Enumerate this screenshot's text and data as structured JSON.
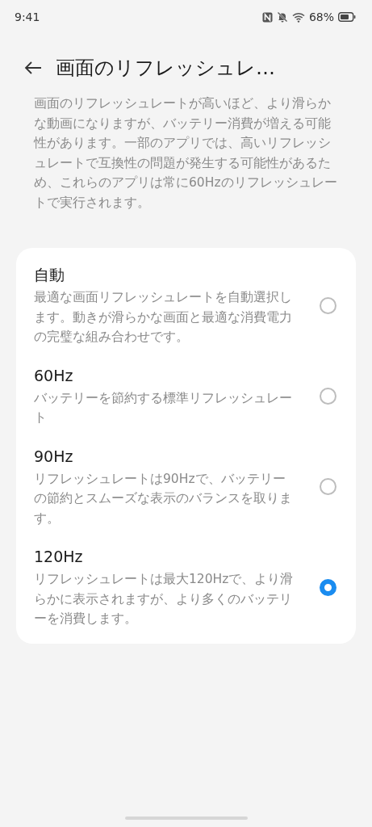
{
  "status_bar": {
    "time": "9:41",
    "battery_percent": "68%"
  },
  "header": {
    "title": "画面のリフレッシュレ…"
  },
  "description": "画面のリフレッシュレートが高いほど、より滑らかな動画になりますが、バッテリー消費が増える可能性があります。一部のアプリでは、高いリフレッシュレートで互換性の問題が発生する可能性があるため、これらのアプリは常に60Hzのリフレッシュレートで実行されます。",
  "options": [
    {
      "title": "自動",
      "description": "最適な画面リフレッシュレートを自動選択します。動きが滑らかな画面と最適な消費電力の完璧な組み合わせです。",
      "selected": false
    },
    {
      "title": "60Hz",
      "description": "バッテリーを節約する標準リフレッシュレート",
      "selected": false
    },
    {
      "title": "90Hz",
      "description": "リフレッシュレートは90Hzで、バッテリーの節約とスムーズな表示のバランスを取ります。",
      "selected": false
    },
    {
      "title": "120Hz",
      "description": "リフレッシュレートは最大120Hzで、より滑らかに表示されますが、より多くのバッテリーを消費します。",
      "selected": true
    }
  ]
}
